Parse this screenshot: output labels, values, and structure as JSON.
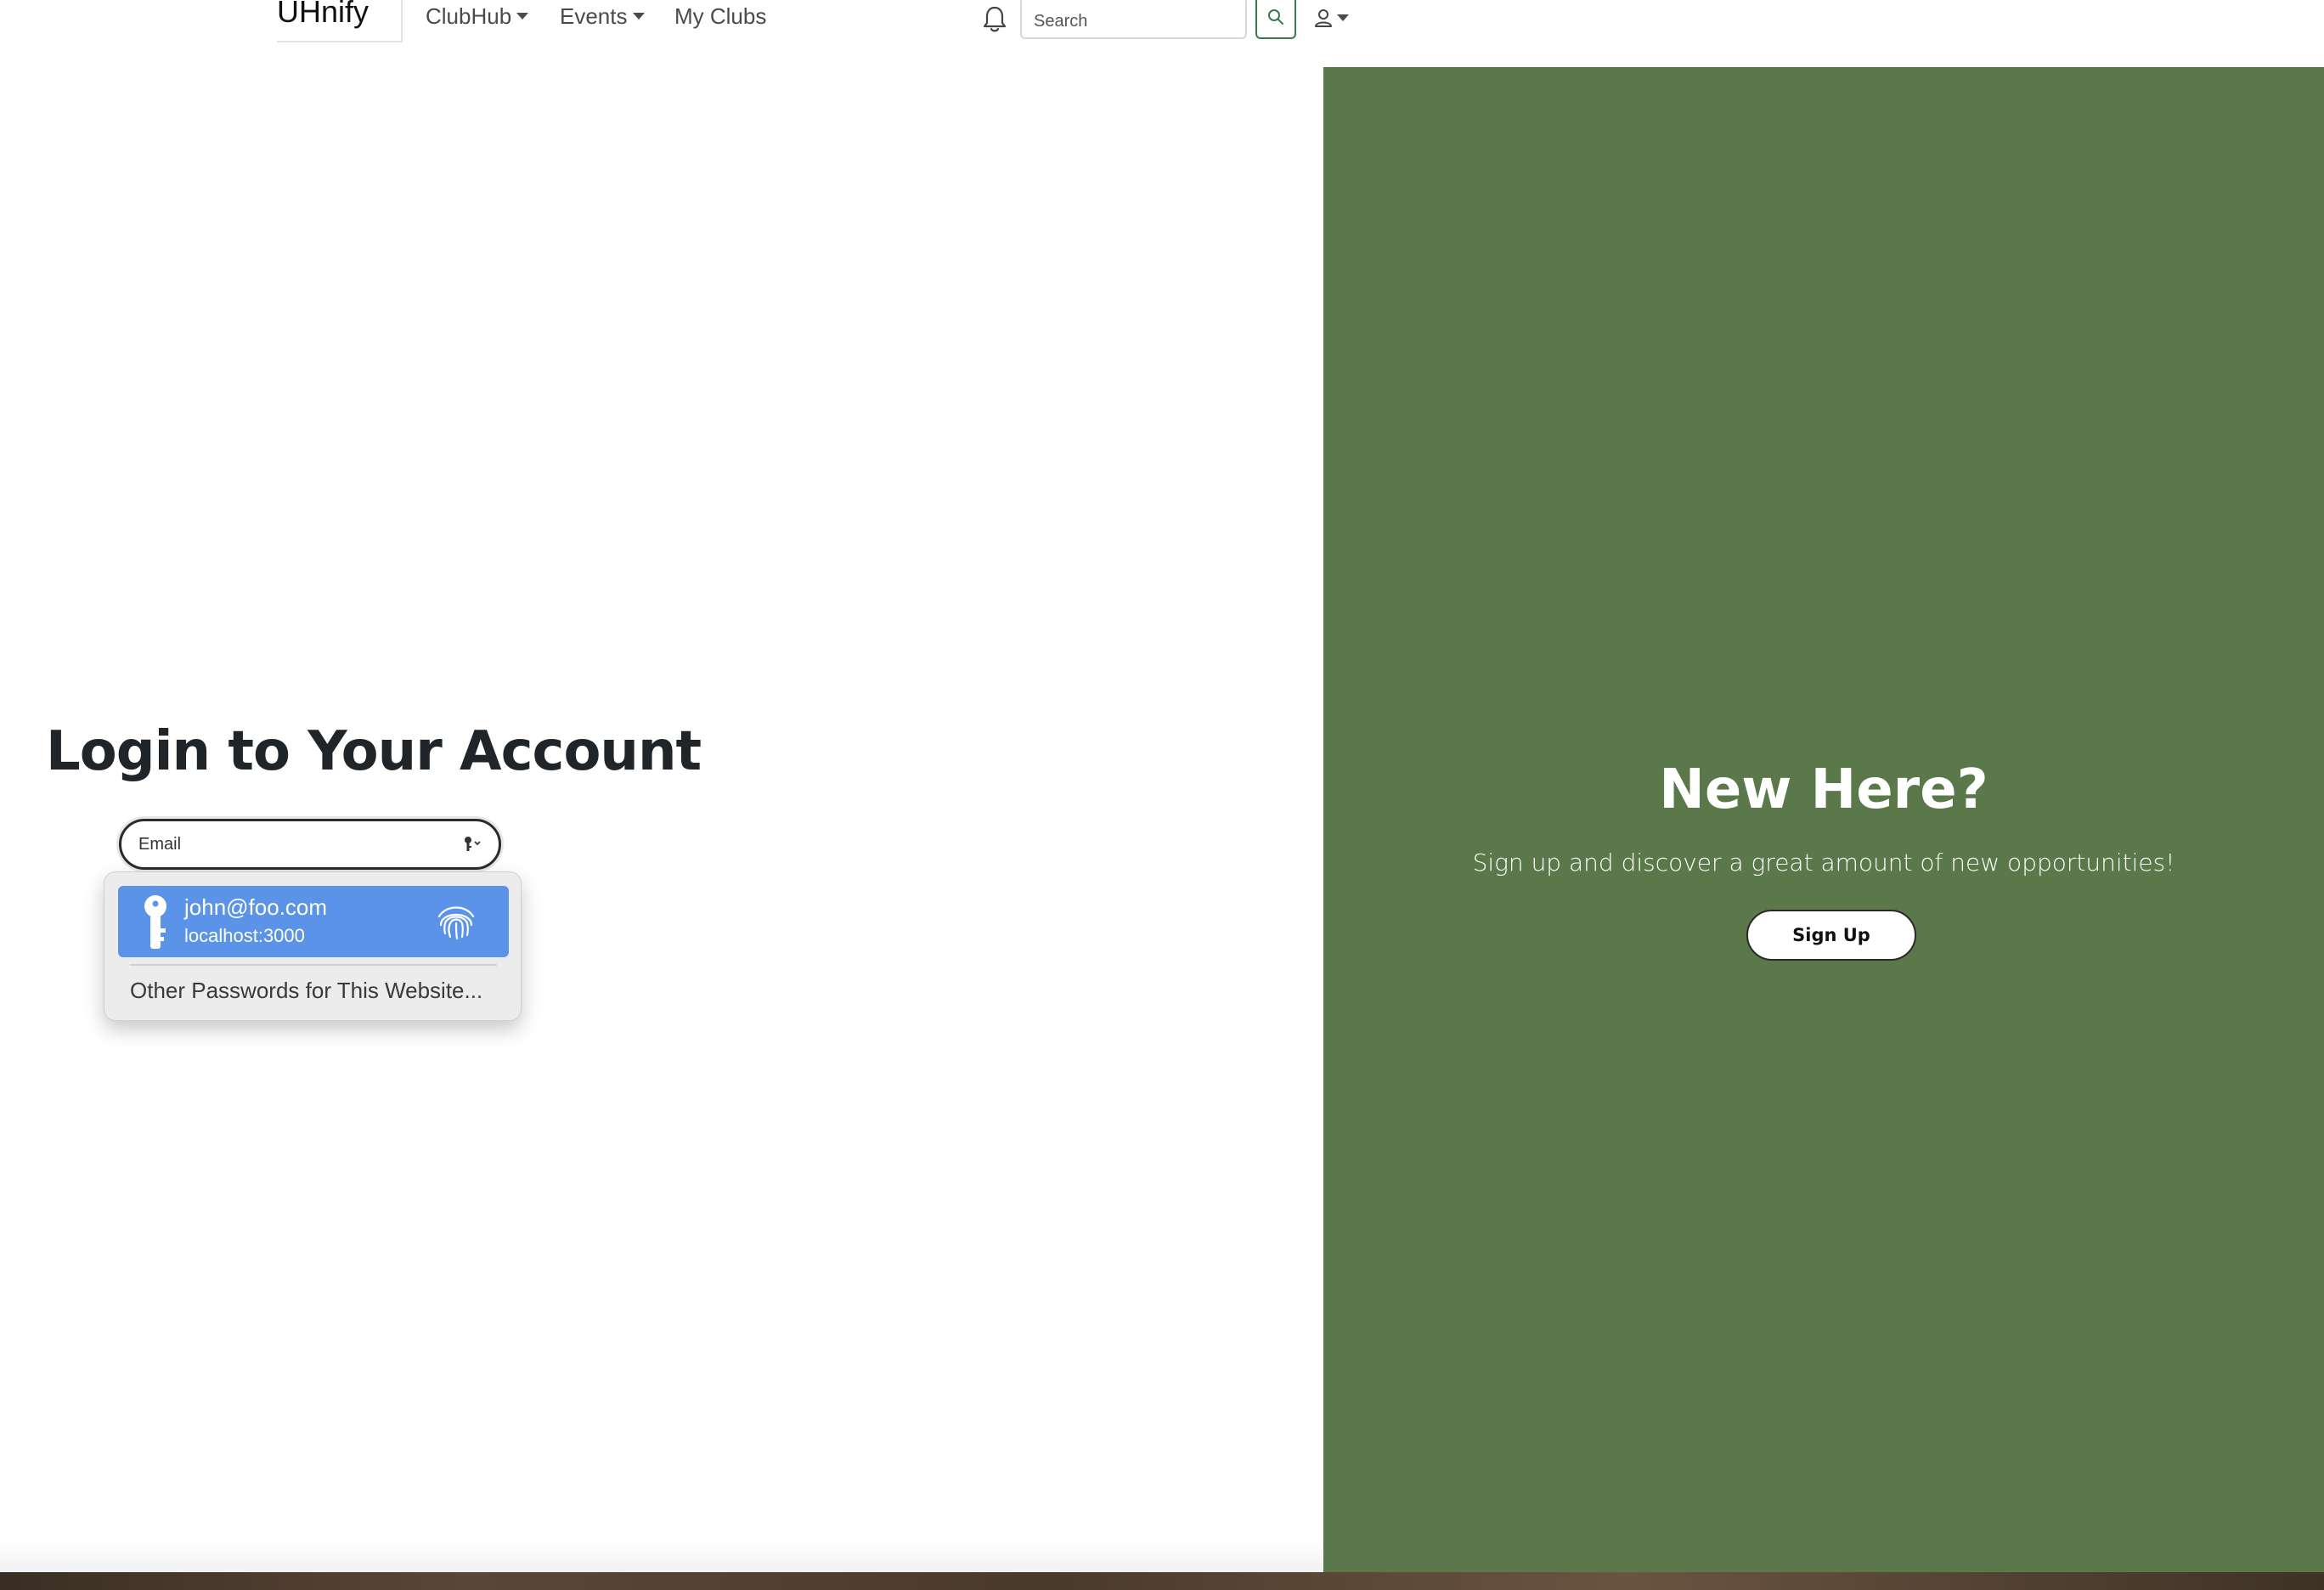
{
  "navbar": {
    "brand": "UHnify",
    "items": [
      {
        "label": "ClubHub",
        "dropdown": true
      },
      {
        "label": "Events",
        "dropdown": true
      },
      {
        "label": "My Clubs",
        "dropdown": false
      }
    ],
    "search_placeholder": "Search",
    "icons": {
      "notifications": "bell-icon",
      "search": "search-icon",
      "user": "user-icon"
    }
  },
  "login": {
    "title": "Login to Your Account",
    "email_placeholder": "Email"
  },
  "autofill": {
    "credential": {
      "username": "john@foo.com",
      "site": "localhost:3000"
    },
    "other_passwords": "Other Passwords for This Website..."
  },
  "signup_panel": {
    "title": "New Here?",
    "subtitle": "Sign up and discover a great amount of new opportunities!",
    "button": "Sign Up"
  },
  "colors": {
    "panel_green": "#5a7849",
    "autofill_blue": "#5a93e8",
    "search_button_border": "#3a7a4a"
  }
}
